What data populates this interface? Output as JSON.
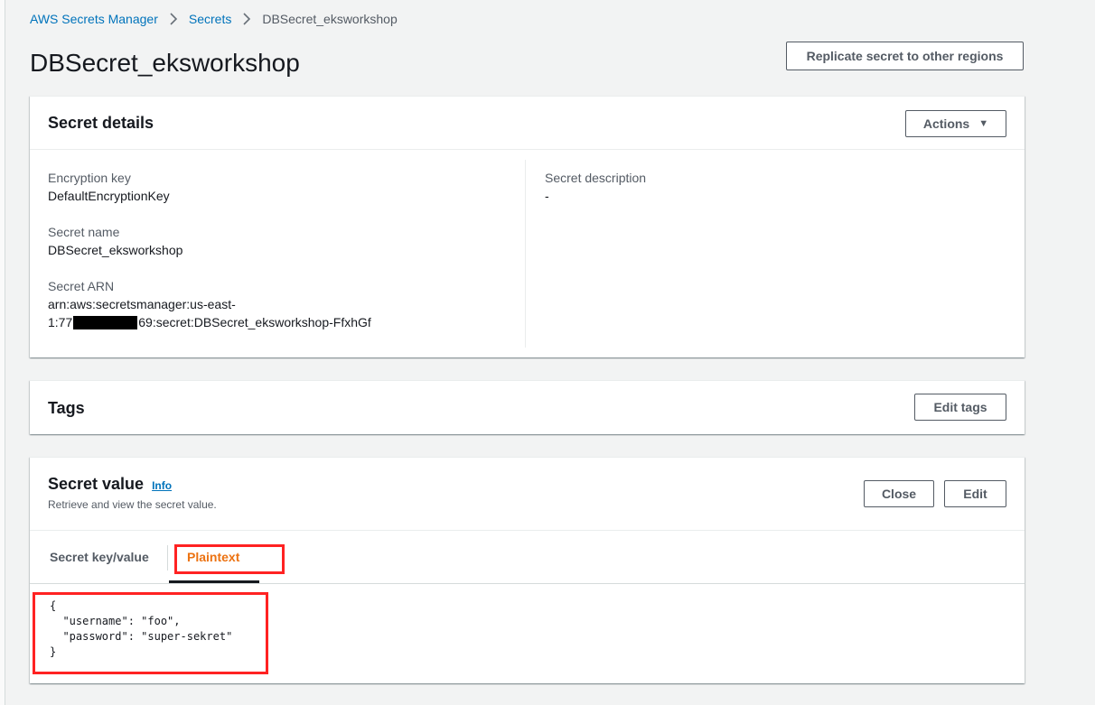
{
  "breadcrumb": {
    "items": [
      "AWS Secrets Manager",
      "Secrets"
    ],
    "current": "DBSecret_eksworkshop"
  },
  "page": {
    "title": "DBSecret_eksworkshop",
    "replicate_button": "Replicate secret to other regions"
  },
  "details": {
    "title": "Secret details",
    "actions_button": "Actions",
    "encryption_key_label": "Encryption key",
    "encryption_key_value": "DefaultEncryptionKey",
    "secret_name_label": "Secret name",
    "secret_name_value": "DBSecret_eksworkshop",
    "arn_label": "Secret ARN",
    "arn_line1": "arn:aws:secretsmanager:us-east-",
    "arn_line2_prefix": "1:77",
    "arn_line2_suffix": "69:secret:DBSecret_eksworkshop-FfxhGf",
    "description_label": "Secret description",
    "description_value": "-"
  },
  "tags": {
    "title": "Tags",
    "edit_button": "Edit tags"
  },
  "secret_value": {
    "title": "Secret value",
    "info_link": "Info",
    "subtitle": "Retrieve and view the secret value.",
    "close_button": "Close",
    "edit_button": "Edit",
    "tabs": [
      "Secret key/value",
      "Plaintext"
    ],
    "active_tab": "Plaintext",
    "plaintext": "{\n  \"username\": \"foo\",\n  \"password\": \"super-sekret\"\n}"
  },
  "colors": {
    "link": "#0073bb",
    "active_tab": "#ec7211",
    "highlight": "#ff2222"
  }
}
